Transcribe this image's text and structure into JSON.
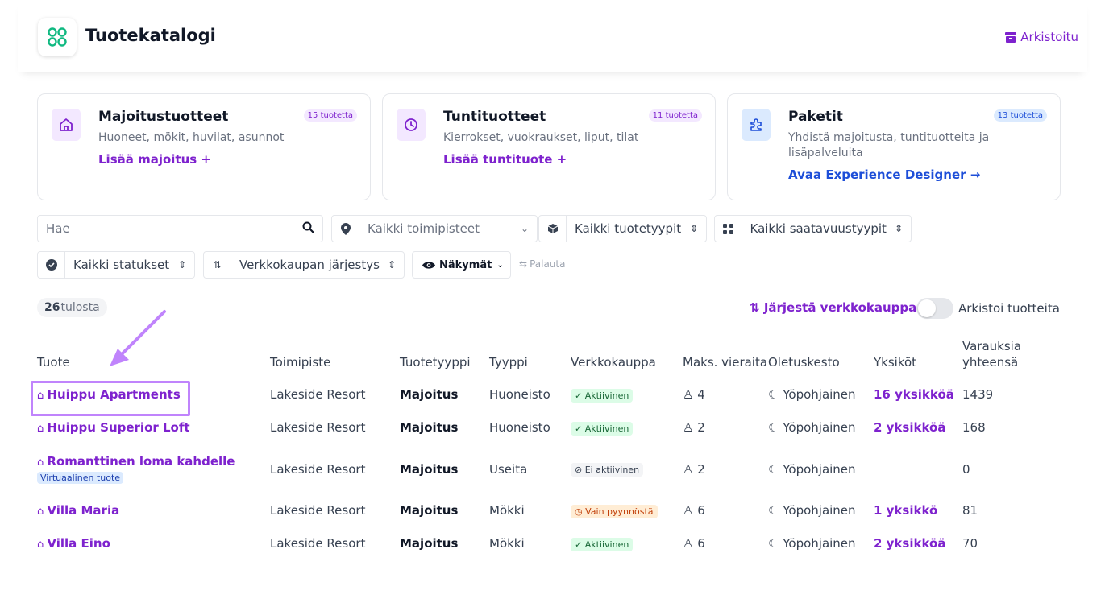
{
  "header": {
    "title": "Tuotekatalogi",
    "archive_label": "Arkistoitu"
  },
  "cards": [
    {
      "title": "Majoitustuotteet",
      "badge": "15 tuotetta",
      "subtitle": "Huoneet, mökit, huvilat, asunnot",
      "link": "Lisää majoitus +"
    },
    {
      "title": "Tuntituotteet",
      "badge": "11 tuotetta",
      "subtitle": "Kierrokset, vuokraukset, liput, tilat",
      "link": "Lisää tuntituote +"
    },
    {
      "title": "Paketit",
      "badge": "13 tuotetta",
      "subtitle": "Yhdistä majoitusta, tuntituotteita ja lisäpalveluita",
      "link": "Avaa Experience Designer →"
    }
  ],
  "filters": {
    "search_placeholder": "Hae",
    "location": "Kaikki toimipisteet",
    "product_type": "Kaikki tuotetyypit",
    "availability": "Kaikki saatavuustyypit",
    "status": "Kaikki statukset",
    "sort": "Verkkokaupan järjestys",
    "views": "Näkymät",
    "reset": "Palauta"
  },
  "results": {
    "count": "26",
    "label": "tulosta"
  },
  "actions": {
    "sort_store": "Järjestä verkkokauppa",
    "archive_products": "Arkistoi tuotteita"
  },
  "table": {
    "headers": [
      "Tuote",
      "Toimipiste",
      "Tuotetyyppi",
      "Tyyppi",
      "Verkkokauppa",
      "Maks. vieraita",
      "Oletuskesto",
      "Yksiköt",
      "Varauksia yhteensä"
    ],
    "rows": [
      {
        "name": "Huippu Apartments",
        "location": "Lakeside Resort",
        "ptype": "Majoitus",
        "type": "Huoneisto",
        "store": "Aktiivinen",
        "guests": "4",
        "duration": "Yöpohjainen",
        "units": "16 yksikköä",
        "bookings": "1439"
      },
      {
        "name": "Huippu Superior Loft",
        "location": "Lakeside Resort",
        "ptype": "Majoitus",
        "type": "Huoneisto",
        "store": "Aktiivinen",
        "guests": "2",
        "duration": "Yöpohjainen",
        "units": "2 yksikköä",
        "bookings": "168"
      },
      {
        "name": "Romanttinen loma kahdelle",
        "tag": "Virtuaalinen tuote",
        "location": "Lakeside Resort",
        "ptype": "Majoitus",
        "type": "Useita",
        "store": "Ei aktiivinen",
        "guests": "2",
        "duration": "Yöpohjainen",
        "units": "",
        "bookings": "0"
      },
      {
        "name": "Villa Maria",
        "location": "Lakeside Resort",
        "ptype": "Majoitus",
        "type": "Mökki",
        "store": "Vain pyynnöstä",
        "guests": "6",
        "duration": "Yöpohjainen",
        "units": "1 yksikkö",
        "bookings": "81"
      },
      {
        "name": "Villa Eino",
        "location": "Lakeside Resort",
        "ptype": "Majoitus",
        "type": "Mökki",
        "store": "Aktiivinen",
        "guests": "6",
        "duration": "Yöpohjainen",
        "units": "2 yksikköä",
        "bookings": "70"
      }
    ]
  }
}
